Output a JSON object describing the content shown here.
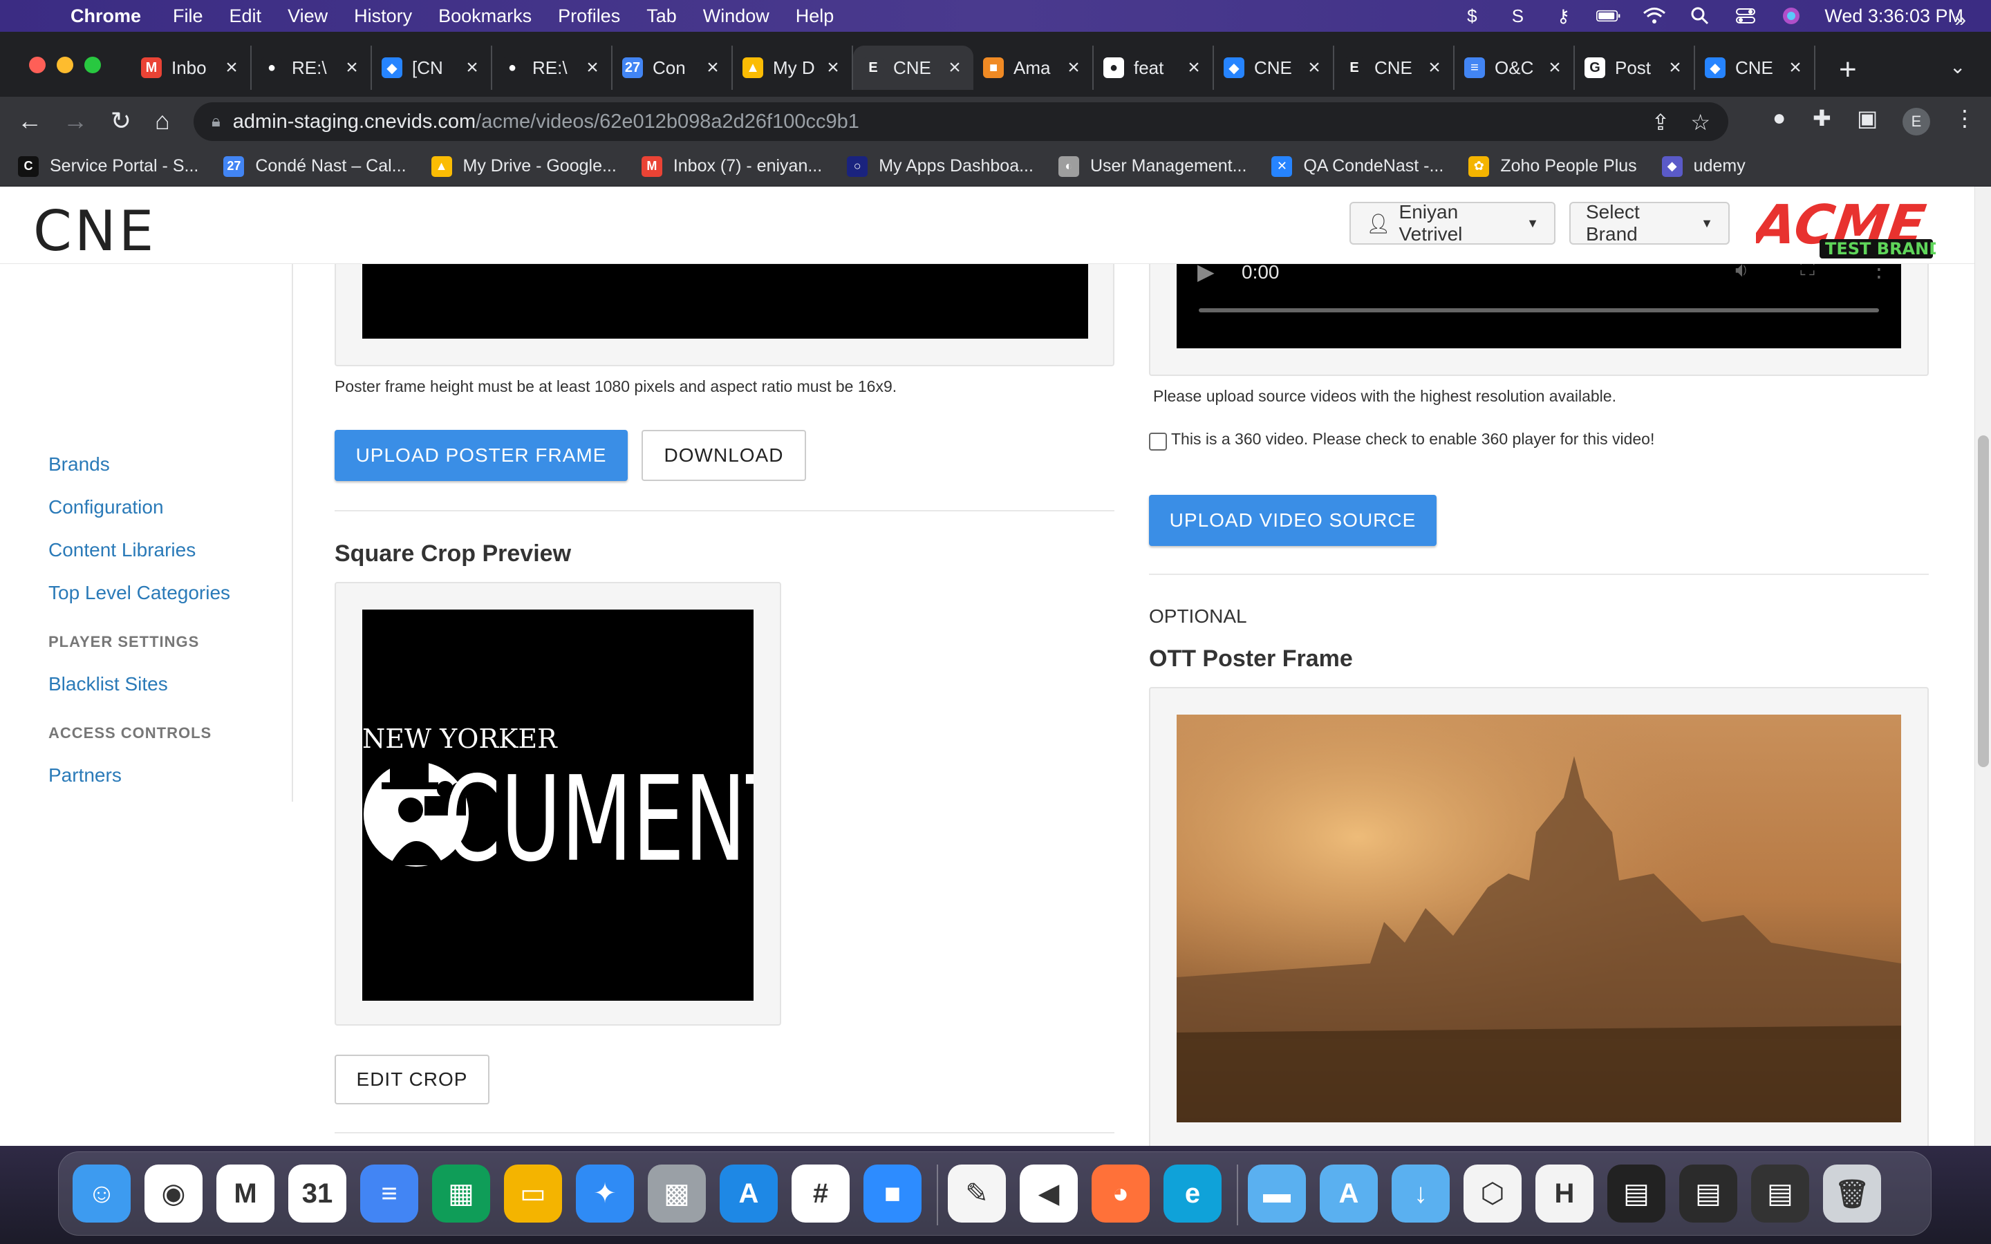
{
  "menubar": {
    "app": "Chrome",
    "items": [
      "File",
      "Edit",
      "View",
      "History",
      "Bookmarks",
      "Profiles",
      "Tab",
      "Window",
      "Help"
    ],
    "clock": "Wed 3:36:03 PM"
  },
  "tabs": [
    {
      "label": "Inbo",
      "favicon": "gmail-icon",
      "color": "#ea4335",
      "glyph": "M"
    },
    {
      "label": "RE:\\",
      "favicon": "github-icon",
      "color": "#202124",
      "glyph": "●"
    },
    {
      "label": "[CN",
      "favicon": "jira-icon",
      "color": "#2684ff",
      "glyph": "◆"
    },
    {
      "label": "RE:\\",
      "favicon": "github-icon",
      "color": "#202124",
      "glyph": "●"
    },
    {
      "label": "Con",
      "favicon": "calendar-icon",
      "color": "#4285f4",
      "glyph": "27"
    },
    {
      "label": "My D",
      "favicon": "drive-icon",
      "color": "#fbbc04",
      "glyph": "▲"
    },
    {
      "label": "CNE",
      "favicon": "cne-icon",
      "color": "#35363a",
      "glyph": "E",
      "active": true
    },
    {
      "label": "Ama",
      "favicon": "box-icon",
      "color": "#f08a24",
      "glyph": "■"
    },
    {
      "label": "feat",
      "favicon": "github-icon",
      "color": "#ffffff",
      "glyph": "●"
    },
    {
      "label": "CNE",
      "favicon": "jira-icon",
      "color": "#2684ff",
      "glyph": "◆"
    },
    {
      "label": "CNE",
      "favicon": "cne-icon",
      "color": "#202124",
      "glyph": "E"
    },
    {
      "label": "O&C",
      "favicon": "docs-icon",
      "color": "#4285f4",
      "glyph": "≡"
    },
    {
      "label": "Post",
      "favicon": "google-icon",
      "color": "#ffffff",
      "glyph": "G"
    },
    {
      "label": "CNE",
      "favicon": "jira-icon",
      "color": "#2684ff",
      "glyph": "◆"
    }
  ],
  "omnibox": {
    "host": "admin-staging.cnevids.com",
    "path": "/acme/videos/62e012b098a2d26f100cc9b1"
  },
  "profile_initial": "E",
  "bookmarks": [
    {
      "label": "Service Portal - S...",
      "color": "#111111",
      "glyph": "C"
    },
    {
      "label": "Condé Nast – Cal...",
      "color": "#4285f4",
      "glyph": "27"
    },
    {
      "label": "My Drive - Google...",
      "color": "#fbbc04",
      "glyph": "▲"
    },
    {
      "label": "Inbox (7) - eniyan...",
      "color": "#ea4335",
      "glyph": "M"
    },
    {
      "label": "My Apps Dashboa...",
      "color": "#1a237e",
      "glyph": "○"
    },
    {
      "label": "User Management...",
      "color": "#9e9e9e",
      "glyph": "◐"
    },
    {
      "label": "QA CondeNast -...",
      "color": "#2684ff",
      "glyph": "✕"
    },
    {
      "label": "Zoho People Plus",
      "color": "#f4b400",
      "glyph": "✿"
    },
    {
      "label": "udemy",
      "color": "#5a5ac8",
      "glyph": "◆"
    }
  ],
  "header": {
    "logo": "CNE",
    "user_button": "Eniyan Vetrivel",
    "brand_button": "Select Brand",
    "brand_logo_main": "ACME",
    "brand_logo_sub": "TEST BRAND"
  },
  "sidebar": {
    "links_top": [
      "Brands",
      "Configuration",
      "Content Libraries",
      "Top Level Categories"
    ],
    "player_heading": "PLAYER SETTINGS",
    "player_links": [
      "Blacklist Sites"
    ],
    "access_heading": "ACCESS CONTROLS",
    "access_links": [
      "Partners"
    ]
  },
  "left_col": {
    "poster_note": "Poster frame height must be at least 1080 pixels and aspect ratio must be 16x9.",
    "upload_poster": "UPLOAD POSTER FRAME",
    "download": "DOWNLOAD",
    "square_title": "Square Crop Preview",
    "square_image_text_top": "NEW YORKER",
    "square_image_text_main": "CUMENTA",
    "edit_crop": "EDIT CROP"
  },
  "right_col": {
    "player_time": "0:00",
    "source_note": "Please upload source videos with the highest resolution available.",
    "checkbox_label": "This is a 360 video. Please check to enable 360 player for this video!",
    "upload_source": "UPLOAD VIDEO SOURCE",
    "optional": "OPTIONAL",
    "ott_title": "OTT Poster Frame"
  },
  "dock_apps": [
    {
      "name": "finder-icon",
      "color": "#3d9bf0",
      "glyph": "☺"
    },
    {
      "name": "chrome-icon",
      "color": "#ffffff",
      "glyph": "◉"
    },
    {
      "name": "gmail-icon",
      "color": "#ffffff",
      "glyph": "M"
    },
    {
      "name": "calendar-icon",
      "color": "#ffffff",
      "glyph": "31"
    },
    {
      "name": "docs-icon",
      "color": "#4285f4",
      "glyph": "≡"
    },
    {
      "name": "sheets-icon",
      "color": "#0f9d58",
      "glyph": "▦"
    },
    {
      "name": "slides-icon",
      "color": "#f4b400",
      "glyph": "▭"
    },
    {
      "name": "safari-icon",
      "color": "#2f8bf5",
      "glyph": "✦"
    },
    {
      "name": "launchpad-icon",
      "color": "#9aa0a6",
      "glyph": "▩"
    },
    {
      "name": "appstore-icon",
      "color": "#1e88e5",
      "glyph": "A"
    },
    {
      "name": "slack-icon",
      "color": "#ffffff",
      "glyph": "#"
    },
    {
      "name": "zoom-icon",
      "color": "#2d8cff",
      "glyph": "■"
    },
    {
      "name": "textedit-icon",
      "color": "#f5f5f5",
      "glyph": "✎"
    },
    {
      "name": "visual-studio-icon",
      "color": "#ffffff",
      "glyph": "◀"
    },
    {
      "name": "firefox-icon",
      "color": "#ff7139",
      "glyph": "◕"
    },
    {
      "name": "edge-icon",
      "color": "#0fa2d9",
      "glyph": "e"
    },
    {
      "name": "folder-icon",
      "color": "#5ab0f0",
      "glyph": "▬"
    },
    {
      "name": "applications-folder-icon",
      "color": "#5ab0f0",
      "glyph": "A"
    },
    {
      "name": "downloads-folder-icon",
      "color": "#5ab0f0",
      "glyph": "↓"
    },
    {
      "name": "hub-icon",
      "color": "#f3f3f3",
      "glyph": "⬡"
    },
    {
      "name": "h-app-icon",
      "color": "#f3f3f3",
      "glyph": "H"
    },
    {
      "name": "window-thumb-icon",
      "color": "#222222",
      "glyph": "▤"
    },
    {
      "name": "window-thumb-icon-2",
      "color": "#2b2b2b",
      "glyph": "▤"
    },
    {
      "name": "window-thumb-icon-3",
      "color": "#333333",
      "glyph": "▤"
    },
    {
      "name": "trash-icon",
      "color": "#cfd3d8",
      "glyph": "🗑"
    }
  ]
}
